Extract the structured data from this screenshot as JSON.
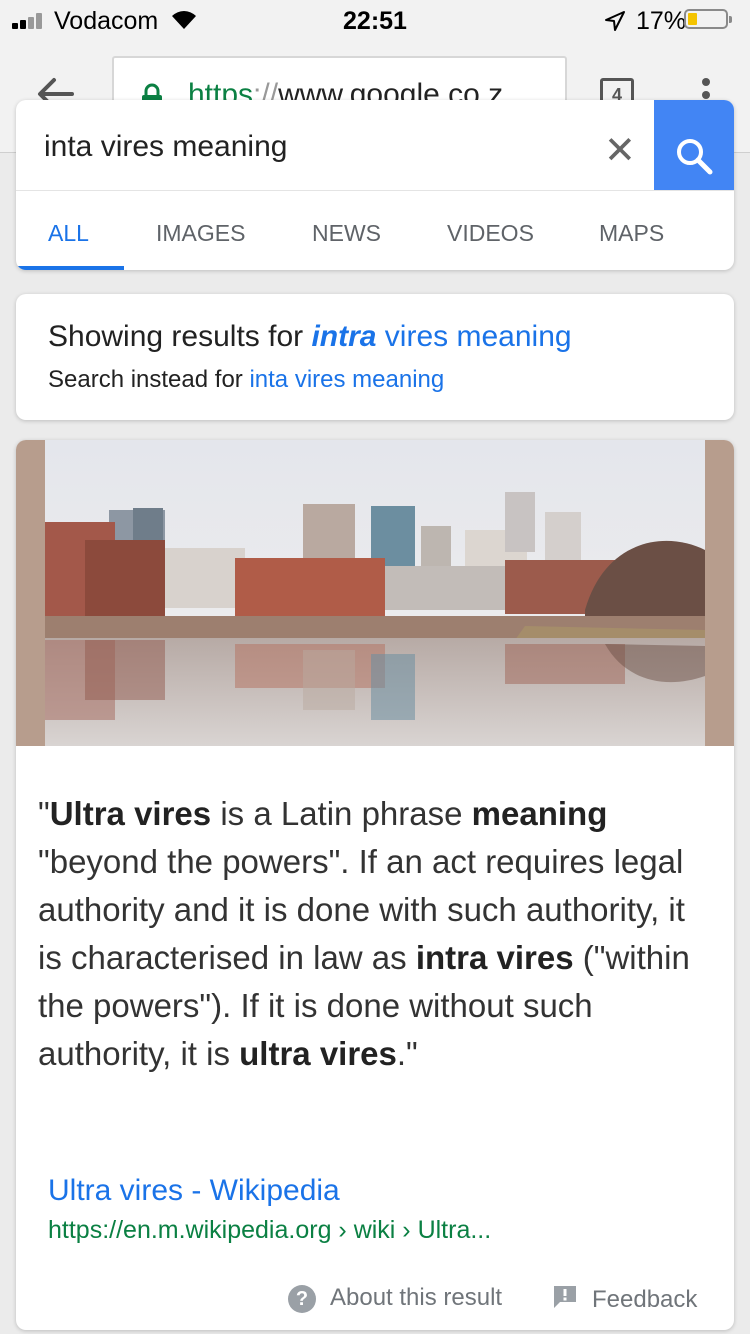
{
  "status_bar": {
    "carrier": "Vodacom",
    "time": "22:51",
    "battery_pct": "17%",
    "battery_level": 0.17,
    "icons": [
      "signal-bars-icon",
      "wifi-icon",
      "location-arrow-icon",
      "battery-icon"
    ]
  },
  "browser": {
    "url_scheme": "https",
    "url_sep": "://",
    "url_host": "www.google.co.z...",
    "tab_count": "4",
    "icons": [
      "back-arrow-icon",
      "lock-icon",
      "tabs-icon",
      "menu-dots-icon"
    ]
  },
  "search": {
    "query": "inta vires meaning",
    "icons": [
      "clear-icon",
      "search-icon"
    ],
    "tabs": [
      {
        "label": "ALL",
        "active": true
      },
      {
        "label": "IMAGES",
        "active": false
      },
      {
        "label": "NEWS",
        "active": false
      },
      {
        "label": "VIDEOS",
        "active": false
      },
      {
        "label": "MAPS",
        "active": false
      }
    ]
  },
  "correction": {
    "prefix": "Showing results for ",
    "corrected_bold": "intra",
    "corrected_rest": " vires meaning",
    "instead_prefix": "Search instead for ",
    "original": "inta vires meaning"
  },
  "answer": {
    "snippet_parts": [
      {
        "text": "\"",
        "bold": false
      },
      {
        "text": "Ultra vires",
        "bold": true
      },
      {
        "text": " is a Latin phrase ",
        "bold": false
      },
      {
        "text": "meaning",
        "bold": true
      },
      {
        "text": " \"beyond the powers\". If an act requires legal authority and it is done with such authority, it is characterised in law as ",
        "bold": false
      },
      {
        "text": "intra vires",
        "bold": true
      },
      {
        "text": " (\"within the powers\"). If it is done without such authority, it is ",
        "bold": false
      },
      {
        "text": "ultra vires",
        "bold": true
      },
      {
        "text": ".\"",
        "bold": false
      }
    ],
    "source_title": "Ultra vires - Wikipedia",
    "source_url": "https://en.m.wikipedia.org › wiki › Ultra...",
    "about_label": "About this result",
    "feedback_label": "Feedback"
  },
  "colors": {
    "link_blue": "#1a73e8",
    "url_green": "#0b8043",
    "search_button": "#4285f4",
    "battery_low": "#f5c400"
  }
}
